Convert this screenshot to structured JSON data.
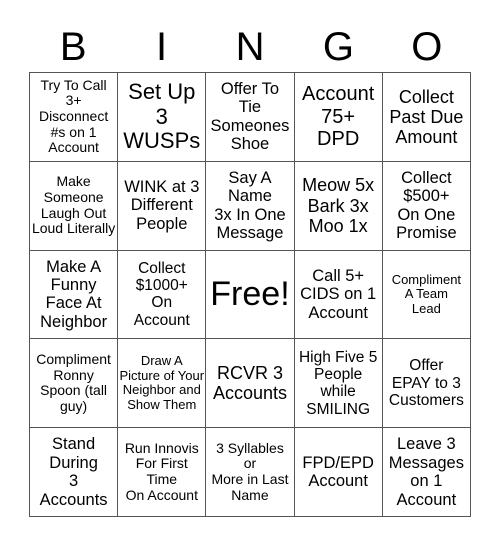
{
  "header": [
    "B",
    "I",
    "N",
    "G",
    "O"
  ],
  "cells": [
    [
      "Try To Call\n3+\nDisconnect\n#s on 1\nAccount",
      "Set Up\n3\nWUSPs",
      "Offer To\nTie\nSomeones\nShoe",
      "Account\n75+\nDPD",
      "Collect\nPast Due\nAmount"
    ],
    [
      "Make\nSomeone\nLaugh Out\nLoud Literally",
      "WINK at 3\nDifferent\nPeople",
      "Say A\nName\n3x In One\nMessage",
      "Meow 5x\nBark 3x\nMoo 1x",
      "Collect\n$500+\nOn One\nPromise"
    ],
    [
      "Make A\nFunny\nFace At\nNeighbor",
      "Collect\n$1000+\nOn\nAccount",
      "Free!",
      "Call 5+\nCIDS on 1\nAccount",
      "Compliment\nA Team\nLead"
    ],
    [
      "Compliment\nRonny\nSpoon (tall\nguy)",
      "Draw A\nPicture of Your\nNeighbor and\nShow Them",
      "RCVR 3\nAccounts",
      "High Five 5\nPeople\nwhile\nSMILING",
      "Offer\nEPAY to 3\nCustomers"
    ],
    [
      "Stand\nDuring\n3\nAccounts",
      "Run Innovis\nFor First\nTime\nOn Account",
      "3 Syllables\nor\nMore in Last\nName",
      "FPD/EPD\nAccount",
      "Leave 3\nMessages\non 1\nAccount"
    ]
  ]
}
